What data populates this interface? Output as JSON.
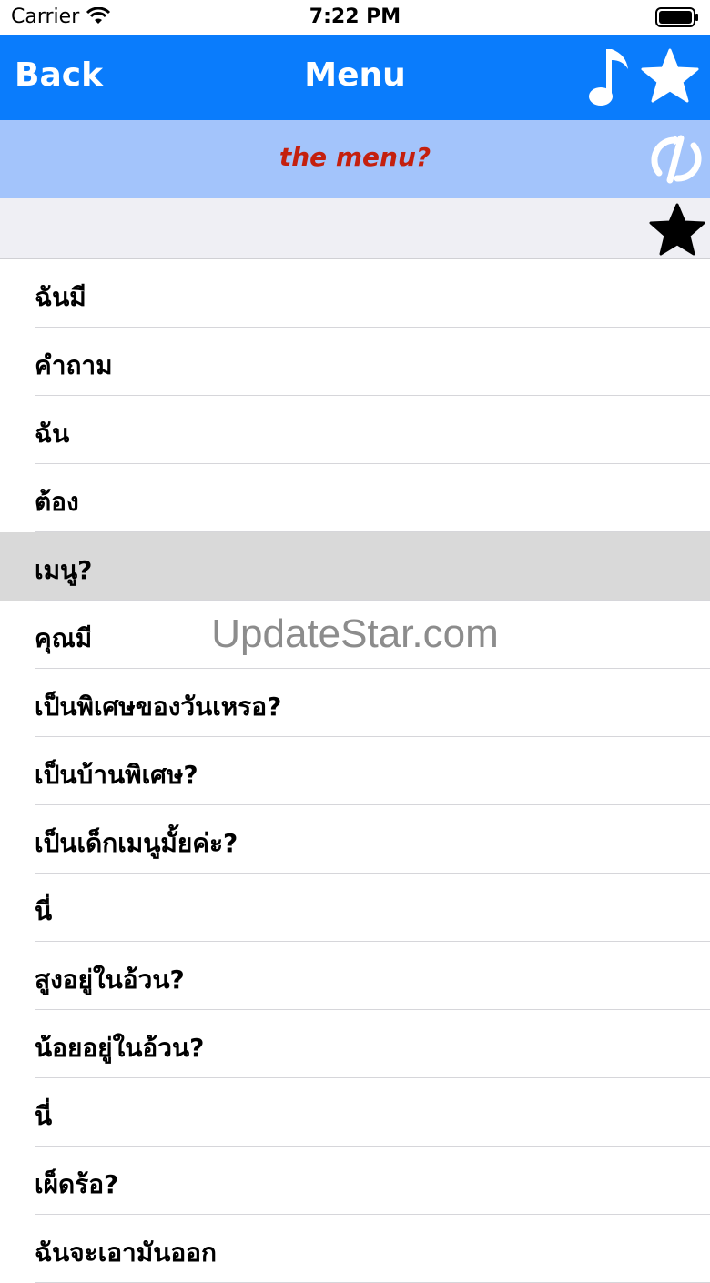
{
  "status_bar": {
    "carrier": "Carrier",
    "time": "7:22 PM"
  },
  "nav": {
    "back_label": "Back",
    "title": "Menu",
    "icons": [
      "music-note-icon",
      "star-icon"
    ],
    "bar_color": "#0a7cfc"
  },
  "banner": {
    "phrase": "the menu?",
    "text_color": "#c4200e",
    "background": "#a3c4fb",
    "icon": "translate-toggle-icon"
  },
  "favorites": {
    "icon": "star-icon"
  },
  "list": {
    "selected_index": 4,
    "items": [
      "ฉันมี",
      "คำถาม",
      "ฉัน",
      "ต้อง",
      "เมนู?",
      "คุณมี",
      "เป็นพิเศษของวันเหรอ?",
      "เป็นบ้านพิเศษ?",
      "เป็นเด็กเมนูมั้ยค่ะ?",
      "นี่",
      "สูงอยู่ในอ้วน?",
      "น้อยอยู่ในอ้วน?",
      "นี่",
      "เผ็ดร้อ?",
      "ฉันจะเอามันออก"
    ]
  },
  "watermark": "UpdateStar.com"
}
